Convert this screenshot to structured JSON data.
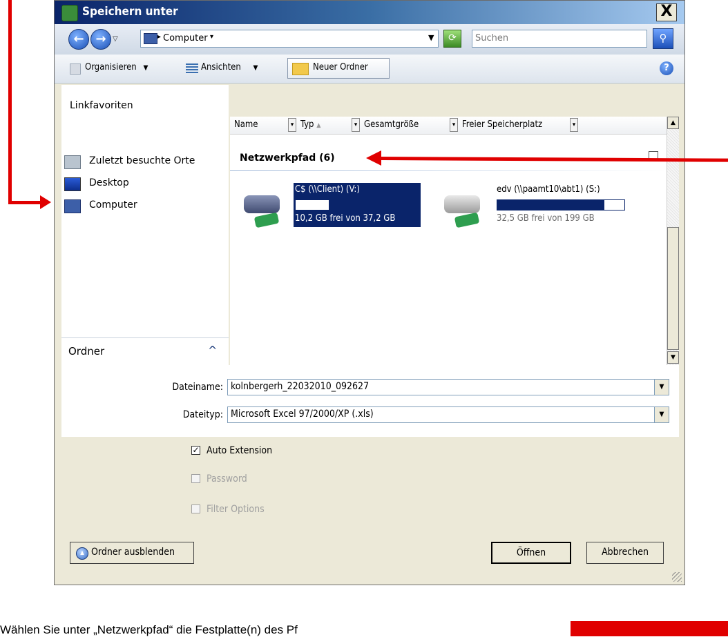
{
  "window": {
    "title": "Speichern unter",
    "close_label": "X"
  },
  "address": {
    "location": "Computer",
    "search_placeholder": "Suchen"
  },
  "toolbar": {
    "organize": "Organisieren",
    "views": "Ansichten",
    "new_folder": "Neuer Ordner"
  },
  "favorites": {
    "heading": "Linkfavoriten",
    "items": [
      {
        "label": "Zuletzt besuchte Orte",
        "icon": "recent-places-icon"
      },
      {
        "label": "Desktop",
        "icon": "desktop-icon"
      },
      {
        "label": "Computer",
        "icon": "computer-icon"
      }
    ]
  },
  "folders_label": "Ordner",
  "columns": [
    "Name",
    "Typ",
    "Gesamtgröße",
    "Freier Speicherplatz"
  ],
  "group": {
    "title": "Netzwerkpfad (6)"
  },
  "drives": [
    {
      "name": "C$ (\\\\Client) (V:)",
      "free_text": "10,2 GB frei von 37,2 GB",
      "used_fraction": 0.73,
      "selected": true
    },
    {
      "name": "edv (\\\\paamt10\\abt1) (S:)",
      "free_text": "32,5 GB frei von 199 GB",
      "used_fraction": 0.84,
      "selected": false
    }
  ],
  "form": {
    "filename_label": "Dateiname:",
    "filename_value": "kolnbergerh_22032010_092627",
    "filetype_label": "Dateityp:",
    "filetype_value": "Microsoft Excel 97/2000/XP (.xls)"
  },
  "options": [
    {
      "label": "Auto Extension",
      "checked": true,
      "enabled": true
    },
    {
      "label": "Password",
      "checked": false,
      "enabled": false
    },
    {
      "label": "Filter Options",
      "checked": false,
      "enabled": false
    }
  ],
  "buttons": {
    "hide_folders": "Ordner ausblenden",
    "open": "Öffnen",
    "cancel": "Abbrechen"
  },
  "footer_text": "Wählen Sie unter „Netzwerkpfad“ die Festplatte(n) des Pf",
  "colors": {
    "annotation": "#e00000",
    "selection": "#0a246a"
  }
}
